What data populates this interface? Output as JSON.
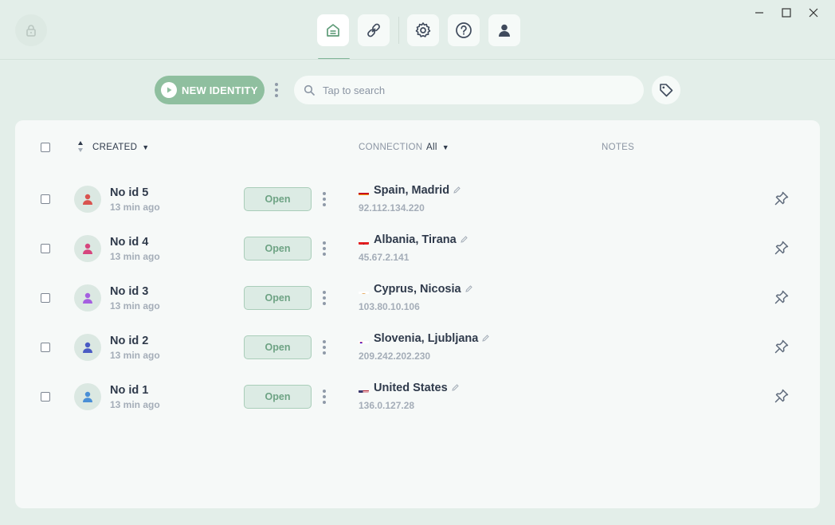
{
  "nav": {
    "items": [
      {
        "icon": "home-icon",
        "active": true
      },
      {
        "icon": "link-icon",
        "active": false
      },
      {
        "icon": "gear-icon",
        "active": false
      },
      {
        "icon": "help-icon",
        "active": false
      },
      {
        "icon": "user-icon",
        "active": false
      }
    ]
  },
  "toolbar": {
    "new_identity_label": "NEW IDENTITY",
    "search_placeholder": "Tap to search"
  },
  "table": {
    "headers": {
      "created": "CREATED",
      "connection": "CONNECTION",
      "connection_filter": "All",
      "notes": "NOTES"
    },
    "rows": [
      {
        "name": "No id 5",
        "time": "13 min ago",
        "open_label": "Open",
        "location": "Spain, Madrid",
        "ip": "92.112.134.220",
        "avatar_color": "#d9534f",
        "flag": "es"
      },
      {
        "name": "No id 4",
        "time": "13 min ago",
        "open_label": "Open",
        "location": "Albania, Tirana",
        "ip": "45.67.2.141",
        "avatar_color": "#d6457d",
        "flag": "al"
      },
      {
        "name": "No id 3",
        "time": "13 min ago",
        "open_label": "Open",
        "location": "Cyprus, Nicosia",
        "ip": "103.80.10.106",
        "avatar_color": "#a55fe0",
        "flag": "cy"
      },
      {
        "name": "No id 2",
        "time": "13 min ago",
        "open_label": "Open",
        "location": "Slovenia, Ljubljana",
        "ip": "209.242.202.230",
        "avatar_color": "#4a5bc4",
        "flag": "si"
      },
      {
        "name": "No id 1",
        "time": "13 min ago",
        "open_label": "Open",
        "location": "United States",
        "ip": "136.0.127.28",
        "avatar_color": "#4a8fd6",
        "flag": "us"
      }
    ]
  },
  "colors": {
    "background": "#e3eee9",
    "accent": "#8fbf9f",
    "panel": "#f6f9f8"
  }
}
